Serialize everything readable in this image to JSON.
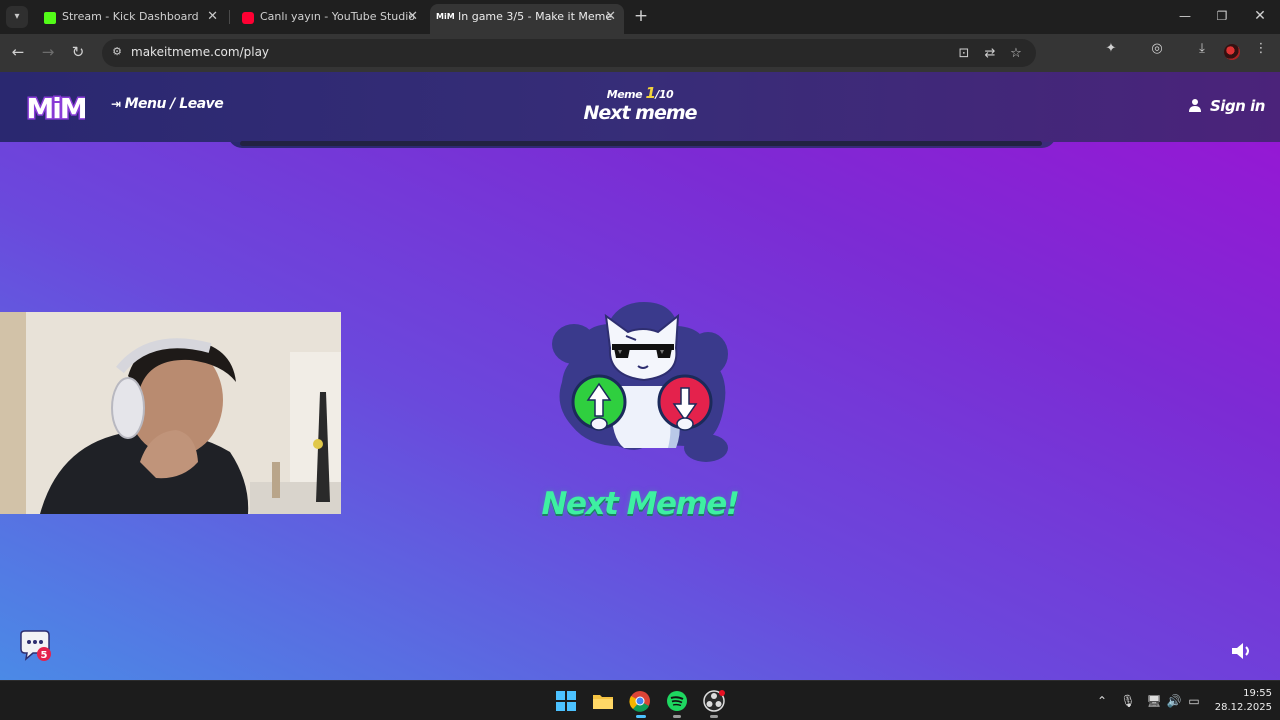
{
  "browser": {
    "tabs": [
      {
        "title": "Stream - Kick Dashboard",
        "favicon": "kick-icon",
        "color": "#53fc18"
      },
      {
        "title": "Canlı yayın - YouTube Studio",
        "favicon": "youtube-icon",
        "color": "#ff0033"
      },
      {
        "title": "In game 3/5 - Make it Meme",
        "favicon": "mim-icon",
        "color": "#ffffff",
        "active": true
      }
    ],
    "url": "makeitmeme.com/play"
  },
  "game": {
    "logo_text": "MiM",
    "menu_leave": "Menu / Leave",
    "round_label": "Meme",
    "round_current": "1",
    "round_total": "/10",
    "round_title": "Next meme",
    "sign_in": "Sign in",
    "next_message": "Next Meme!",
    "chat_badge": "5",
    "progress_value": 0
  },
  "taskbar": {
    "time": "19:55",
    "date": "28.12.2025"
  },
  "colors": {
    "accent_green": "#3ef0a2",
    "round_number": "#f3d33b",
    "vote_up": "#2fcf3f",
    "vote_down": "#e4224c"
  }
}
